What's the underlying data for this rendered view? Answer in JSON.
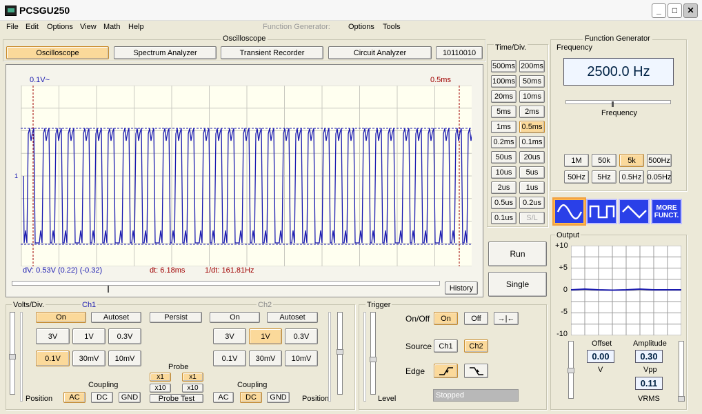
{
  "window": {
    "title": "PCSGU250",
    "minimize": "_",
    "maximize": "□",
    "close": "✕"
  },
  "menu": {
    "file": "File",
    "edit": "Edit",
    "options": "Options",
    "view": "View",
    "math": "Math",
    "help": "Help",
    "fg_label": "Function Generator:",
    "fg_options": "Options",
    "fg_tools": "Tools"
  },
  "osc": {
    "group_title": "Oscilloscope",
    "tabs": [
      "Oscilloscope",
      "Spectrum Analyzer",
      "Transient Recorder",
      "Circuit Analyzer",
      "10110010"
    ],
    "marker_left": "0.1V~",
    "marker_right": "0.5ms",
    "ch_marker": "1",
    "dv": "dV: 0.53V  (0.22) (-0.32)",
    "dt": "dt: 6.18ms",
    "inv_dt": "1/dt: 161.81Hz",
    "history": "History"
  },
  "timediv": {
    "title": "Time/Div.",
    "buttons": [
      "500ms",
      "200ms",
      "100ms",
      "50ms",
      "20ms",
      "10ms",
      "5ms",
      "2ms",
      "1ms",
      "0.5ms",
      "0.2ms",
      "0.1ms",
      "50us",
      "20us",
      "10us",
      "5us",
      "2us",
      "1us",
      "0.5us",
      "0.2us",
      "0.1us",
      "S/L"
    ],
    "selected": "0.5ms",
    "run": "Run",
    "single": "Single"
  },
  "volts": {
    "title": "Volts/Div.",
    "ch1": "Ch1",
    "ch2": "Ch2",
    "on": "On",
    "autoset": "Autoset",
    "persist": "Persist",
    "ranges": [
      "3V",
      "1V",
      "0.3V",
      "0.1V",
      "30mV",
      "10mV"
    ],
    "ch1_selected": "0.1V",
    "ch2_selected": "1V",
    "probe": "Probe",
    "x1": "x1",
    "x10": "x10",
    "probe_test": "Probe Test",
    "coupling": "Coupling",
    "ac": "AC",
    "dc": "DC",
    "gnd": "GND",
    "ch1_coupling": "AC",
    "ch2_coupling": "DC",
    "position": "Position"
  },
  "trigger": {
    "title": "Trigger",
    "onoff": "On/Off",
    "on": "On",
    "off": "Off",
    "expand": "→|←",
    "source": "Source",
    "ch1": "Ch1",
    "ch2": "Ch2",
    "edge": "Edge",
    "level": "Level",
    "status": "Stopped"
  },
  "fg": {
    "title": "Function Generator",
    "frequency_label": "Frequency",
    "frequency": "2500.0 Hz",
    "slider_label": "Frequency",
    "ranges": [
      "1M",
      "50k",
      "5k",
      "500Hz",
      "50Hz",
      "5Hz",
      "0.5Hz",
      "0.05Hz"
    ],
    "selected_range": "5k",
    "more": "MORE FUNCT.",
    "output": "Output",
    "y_ticks": [
      "+10",
      "+5",
      "0",
      "-5",
      "-10"
    ],
    "offset_label": "Offset",
    "offset": "0.00",
    "offset_unit": "V",
    "amplitude_label": "Amplitude",
    "amplitude": "0.30",
    "vpp": "Vpp",
    "vrms_value": "0.11",
    "vrms": "VRMS"
  },
  "colors": {
    "trace": "#1a1ab0",
    "active": "#fbd99a",
    "cursor": "#a00000"
  }
}
